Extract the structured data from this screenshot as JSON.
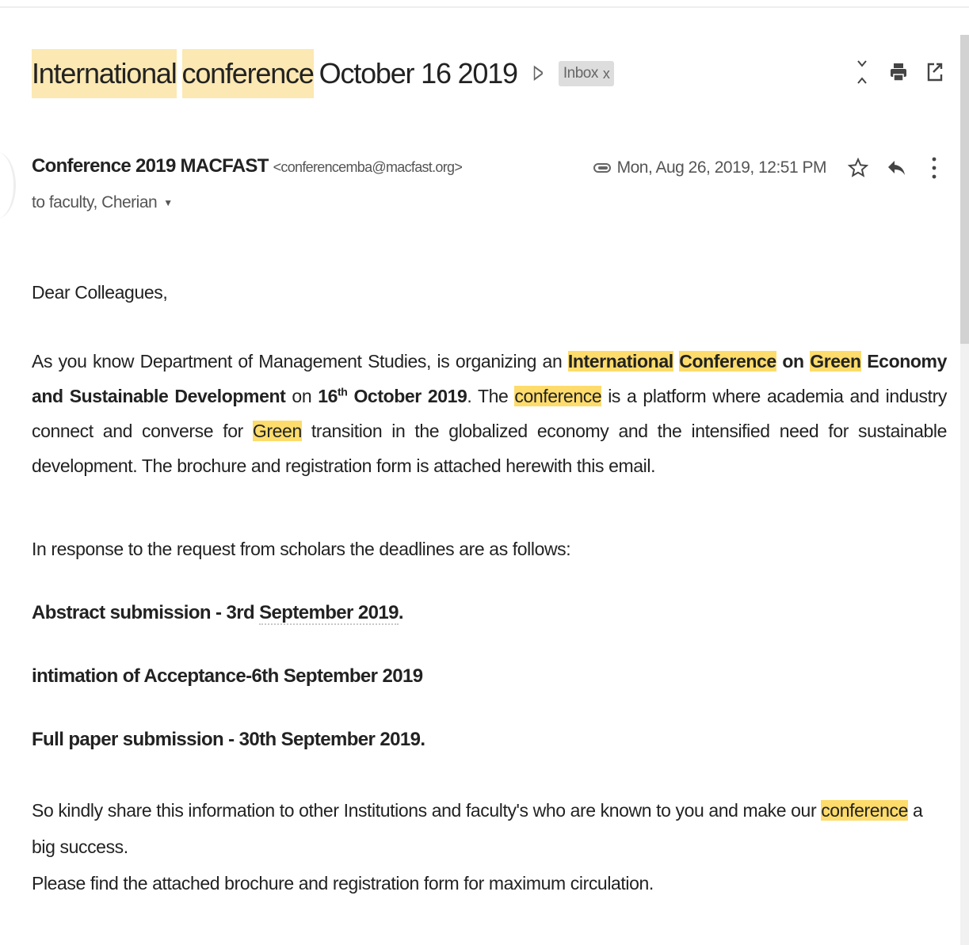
{
  "header": {
    "subject_words": [
      "International",
      "conference",
      "October 16 2019"
    ],
    "label": "Inbox",
    "label_remove": "x"
  },
  "message": {
    "sender_name": "Conference 2019 MACFAST",
    "sender_email": "<conferencemba@macfast.org>",
    "recipients": "to faculty, Cherian",
    "date": "Mon, Aug 26, 2019, 12:51 PM"
  },
  "body": {
    "greeting": "Dear Colleagues,",
    "p1": {
      "t1": "As you know Department of Management Studies,  is organizing an ",
      "international": "International",
      "conference_cap": "Conference",
      "on": "on",
      "green": "Green",
      "economy": "Economy and Sustainable Development",
      "t2": " on ",
      "date_bold": "16",
      "sup": "th",
      "month_bold": " October 2019",
      "t3": ". The ",
      "conference": "conference",
      "t4": " is a platform where academia and industry connect and converse for ",
      "green2": "Green",
      "t5": " transition in the globalized economy and the intensified need for sustainable development.  The brochure and registration form is attached herewith this email."
    },
    "intro2": "In response to the request from scholars the deadlines are  as follows:",
    "deadlines": {
      "d1_pre": "Abstract submission - 3rd ",
      "d1_date": "September 2019",
      "d1_post": ".",
      "d2": "intimation of Acceptance-6th September 2019",
      "d3": "Full paper submission - 30th September 2019."
    },
    "closing": {
      "c1_pre": "So  kindly share this information to other Institutions and faculty's who are known to you and make our ",
      "c1_hl": "conference",
      "c1_post": " a big success.",
      "c2": "Please find the attached brochure and registration form for maximum circulation."
    }
  },
  "colors": {
    "highlight": "#fce8b2",
    "highlight_strong": "#fddc6c",
    "deadline_red": "#ff0000"
  },
  "icons": {
    "importance": "importance-marker-icon",
    "expand": "expand-collapse-icon",
    "print": "print-icon",
    "popout": "open-new-window-icon",
    "attachment": "attachment-icon",
    "star": "star-icon",
    "reply": "reply-icon",
    "more": "more-vertical-icon"
  }
}
